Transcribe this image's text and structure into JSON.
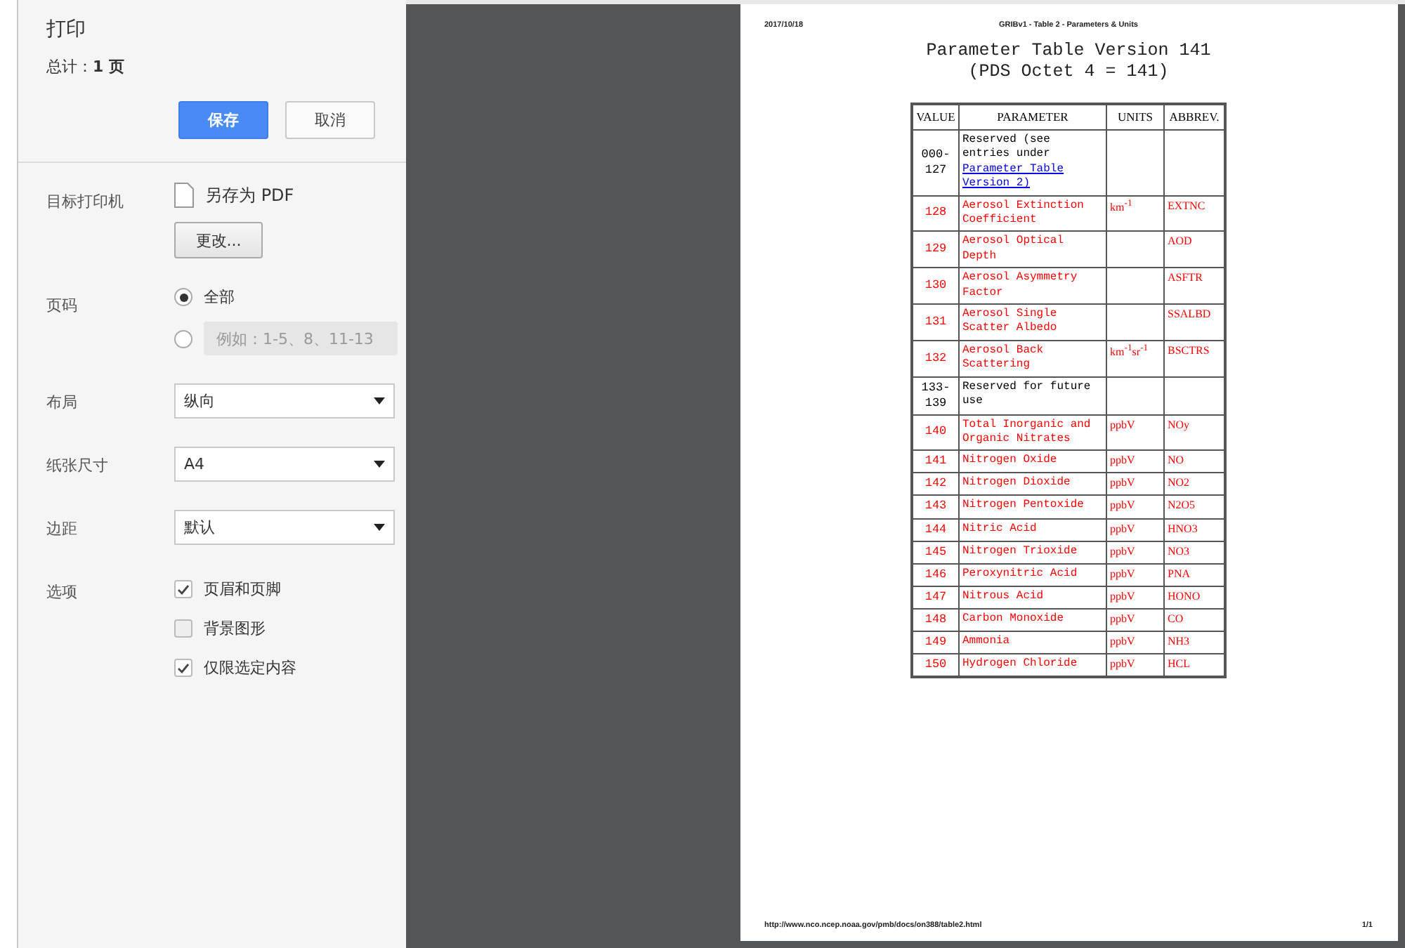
{
  "panel": {
    "title": "打印",
    "total_label": "总计：",
    "total_value": "1 页",
    "primary_button": "保存",
    "cancel_button": "取消"
  },
  "settings": [
    {
      "kind": "printer",
      "label": "目标打印机",
      "value": "另存为 PDF",
      "button": "更改..."
    },
    {
      "kind": "pages",
      "label": "页码",
      "options": [
        {
          "label": "全部",
          "selected": true
        },
        {
          "placeholder": "例如：1-5、8、11-13",
          "selected": false
        }
      ]
    },
    {
      "kind": "select",
      "label": "布局",
      "value": "纵向"
    },
    {
      "kind": "select",
      "label": "纸张尺寸",
      "value": "A4"
    },
    {
      "kind": "select",
      "label": "边距",
      "value": "默认"
    },
    {
      "kind": "checks",
      "label": "选项",
      "options": [
        {
          "label": "页眉和页脚",
          "checked": true
        },
        {
          "label": "背景图形",
          "checked": false
        },
        {
          "label": "仅限选定内容",
          "checked": true
        }
      ]
    }
  ],
  "preview": {
    "date": "2017/10/18",
    "header": "GRIBv1 - Table 2 - Parameters & Units",
    "title_lines": [
      "Parameter Table Version 141",
      "(PDS Octet 4 = 141)"
    ],
    "columns": [
      "VALUE",
      "PARAMETER",
      "UNITS",
      "ABBREV."
    ],
    "rows": [
      {
        "value": "000-127",
        "parameter": "Reserved (see entries under",
        "link": "Parameter Table Version 2)",
        "color": "#000000"
      },
      {
        "value": "128",
        "parameter": "Aerosol Extinction Coefficient",
        "units": "km$^{-1}$",
        "abbrev": "EXTNC",
        "color": "#ff0000"
      },
      {
        "value": "129",
        "parameter": "Aerosol Optical Depth",
        "abbrev": "AOD",
        "color": "#ff0000"
      },
      {
        "value": "130",
        "parameter": "Aerosol Asymmetry Factor",
        "abbrev": "ASFTR",
        "color": "#ff0000"
      },
      {
        "value": "131",
        "parameter": "Aerosol Single Scatter Albedo",
        "abbrev": "SSALBD",
        "color": "#ff0000"
      },
      {
        "value": "132",
        "parameter": "Aerosol Back Scattering",
        "units": "km$^{-1}$sr$^{-1}$",
        "abbrev": "BSCTRS",
        "color": "#ff0000"
      },
      {
        "value": "133-139",
        "parameter": "Reserved for future use",
        "color": "#000000"
      },
      {
        "value": "140",
        "parameter": "Total Inorganic and Organic Nitrates",
        "units": "ppbV",
        "abbrev": "NOy",
        "color": "#ff0000"
      },
      {
        "value": "141",
        "parameter": "Nitrogen Oxide",
        "units": "ppbV",
        "abbrev": "NO",
        "color": "#ff0000"
      },
      {
        "value": "142",
        "parameter": "Nitrogen Dioxide",
        "units": "ppbV",
        "abbrev": "NO2",
        "color": "#ff0000"
      },
      {
        "value": "143",
        "parameter": "Nitrogen Pentoxide",
        "units": "ppbV",
        "abbrev": "N2O5",
        "color": "#ff0000"
      },
      {
        "value": "144",
        "parameter": "Nitric Acid",
        "units": "ppbV",
        "abbrev": "HNO3",
        "color": "#ff0000"
      },
      {
        "value": "145",
        "parameter": "Nitrogen Trioxide",
        "units": "ppbV",
        "abbrev": "NO3",
        "color": "#ff0000"
      },
      {
        "value": "146",
        "parameter": "Peroxynitric Acid",
        "units": "ppbV",
        "abbrev": "PNA",
        "color": "#ff0000"
      },
      {
        "value": "147",
        "parameter": "Nitrous Acid",
        "units": "ppbV",
        "abbrev": "HONO",
        "color": "#ff0000"
      },
      {
        "value": "148",
        "parameter": "Carbon Monoxide",
        "units": "ppbV",
        "abbrev": "CO",
        "color": "#ff0000"
      },
      {
        "value": "149",
        "parameter": "Ammonia",
        "units": "ppbV",
        "abbrev": "NH3",
        "color": "#ff0000"
      },
      {
        "value": "150",
        "parameter": "Hydrogen Chloride",
        "units": "ppbV",
        "abbrev": "HCL",
        "color": "#ff0000"
      }
    ],
    "footer_url": "http://www.nco.ncep.noaa.gov/pmb/docs/on388/table2.html",
    "footer_page": "1/1"
  }
}
